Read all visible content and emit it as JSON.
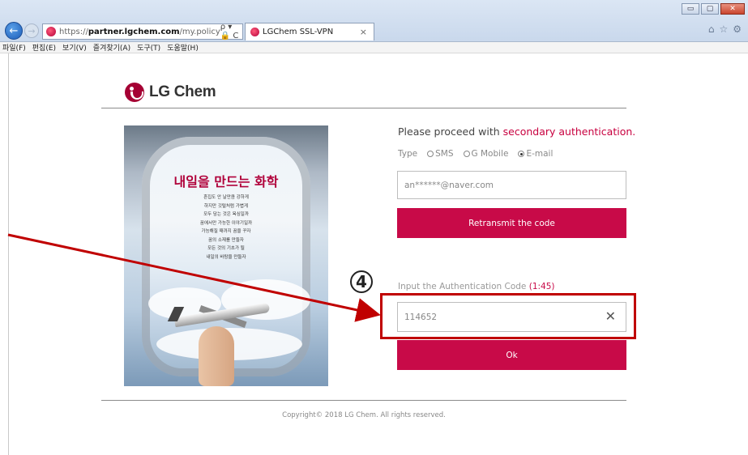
{
  "browser": {
    "url_prefix": "https://",
    "url_host": "partner.lgchem.com",
    "url_path": "/my.policy",
    "addr_tools": "ρ ▾ 🔒 C",
    "tab_title": "LGChem SSL-VPN",
    "tab_close": "×",
    "back_glyph": "←",
    "forward_glyph": "→",
    "window_buttons": [
      "▭",
      "▢",
      "✕"
    ],
    "right_tools": [
      "⌂",
      "☆",
      "⚙"
    ],
    "menu": [
      "파일(F)",
      "편집(E)",
      "보기(V)",
      "즐겨찾기(A)",
      "도구(T)",
      "도움말(H)"
    ]
  },
  "page": {
    "logo_text": "LG Chem",
    "poster": {
      "title": "내일을 만드는 화학",
      "lines": [
        "흔집도 안 날만큼 강하게",
        "하지만 깃털처럼 가볍게",
        "모두 담는 것은 욕심일까",
        "꿈에서만 가능한 이야기일까",
        "가능해질 때까지 꿈을 꾸자",
        "꿈의 소재를 만들자",
        "모든 것의 기초가 될",
        "내일의 바탕을 만들자"
      ]
    },
    "auth": {
      "heading_prefix": "Please proceed with ",
      "heading_accent": "secondary authentication.",
      "type_label": "Type",
      "options": [
        "SMS",
        "G Mobile",
        "E-mail"
      ],
      "selected_option": "E-mail",
      "email_value": "an******@naver.com",
      "retransmit_label": "Retransmit the code",
      "code_label": "Input the Authentication Code ",
      "code_timer": "(1:45)",
      "code_value": "114652",
      "clear_glyph": "✕",
      "ok_label": "Ok"
    },
    "annotation": {
      "step_number": "4",
      "highlight_color": "#c00000"
    },
    "copyright": "Copyright© 2018 LG Chem. All rights reserved."
  },
  "colors": {
    "brand": "#a50034",
    "button": "#c80a48",
    "accent_text": "#c8003f"
  }
}
